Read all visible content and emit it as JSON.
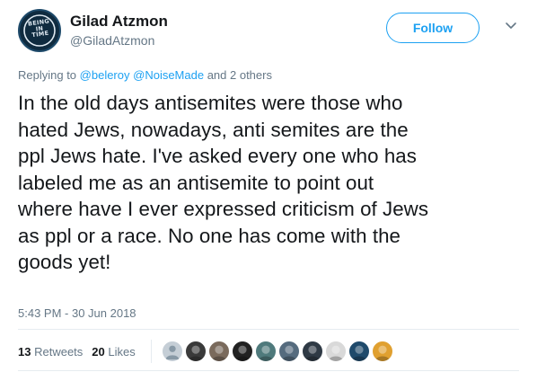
{
  "author": {
    "display_name": "Gilad Atzmon",
    "handle": "@GiladAtzmon",
    "avatar_text": "BEING IN TIME"
  },
  "follow_label": "Follow",
  "reply": {
    "prefix": "Replying to ",
    "mention_1": "@beleroy",
    "mention_2": "@NoiseMade",
    "suffix": " and 2 others"
  },
  "tweet": {
    "text": "In the old days antisemites were those who\nhated Jews, nowadays, anti semites are the\nppl Jews hate. I've asked every one who has\nlabeled me as an antisemite to point out\nwhere have I ever expressed criticism of Jews\nas ppl or a race.  No one has come with the\ngoods yet!",
    "timestamp": "5:43 PM - 30 Jun 2018"
  },
  "stats": {
    "retweets_count": "13",
    "retweets_label": "Retweets",
    "likes_count": "20",
    "likes_label": "Likes"
  },
  "colors": {
    "accent": "#1da1f2",
    "secondary_text": "#657786",
    "primary_text": "#14171a",
    "divider": "#e6ecf0"
  },
  "liker_avatars": [
    {
      "name": "default-avatar-icon",
      "color": "#c5ced6"
    },
    {
      "name": "liker-avatar-2",
      "color": "#3a3a3a"
    },
    {
      "name": "liker-avatar-3",
      "color": "#7a6a5c"
    },
    {
      "name": "liker-avatar-4",
      "color": "#222222"
    },
    {
      "name": "liker-avatar-5",
      "color": "#4f7a7c"
    },
    {
      "name": "liker-avatar-6",
      "color": "#556b7e"
    },
    {
      "name": "liker-avatar-7",
      "color": "#2f3a45"
    },
    {
      "name": "liker-avatar-8",
      "color": "#d9d9d9"
    },
    {
      "name": "liker-avatar-9",
      "color": "#1f4a6b"
    },
    {
      "name": "liker-avatar-10",
      "color": "#e0a030"
    }
  ]
}
